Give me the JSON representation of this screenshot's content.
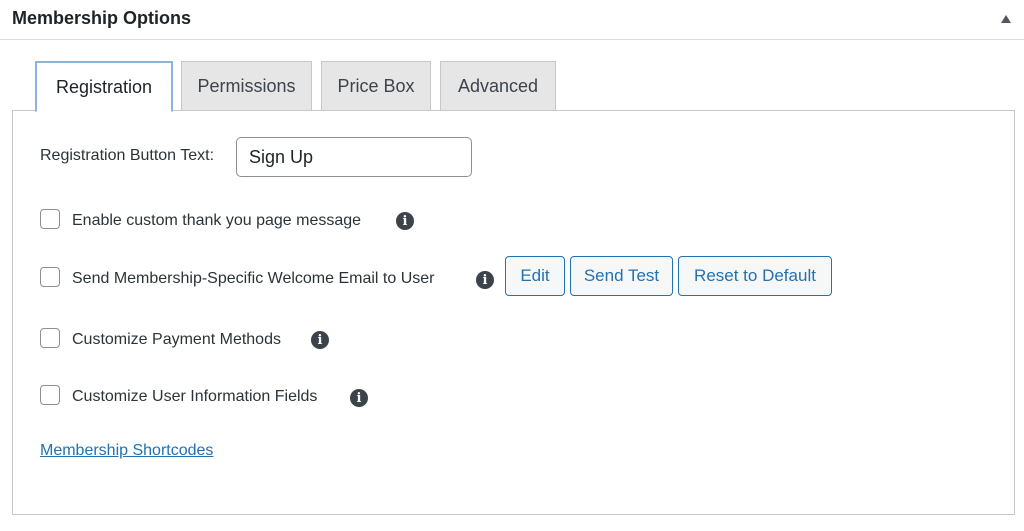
{
  "metabox": {
    "title": "Membership Options",
    "collapse_icon": "triangle-up-icon"
  },
  "tabs": [
    {
      "label": "Registration",
      "active": true
    },
    {
      "label": "Permissions",
      "active": false
    },
    {
      "label": "Price Box",
      "active": false
    },
    {
      "label": "Advanced",
      "active": false
    }
  ],
  "registration": {
    "button_text_label": "Registration Button Text:",
    "button_text_value": "Sign Up",
    "options": [
      {
        "label": "Enable custom thank you page message",
        "checked": false,
        "info_icon": "info-icon"
      },
      {
        "label": "Send Membership-Specific Welcome Email to User",
        "checked": false,
        "info_icon": "info-icon"
      },
      {
        "label": "Customize Payment Methods",
        "checked": false,
        "info_icon": "info-icon"
      },
      {
        "label": "Customize User Information Fields",
        "checked": false,
        "info_icon": "info-icon"
      }
    ],
    "email_buttons": {
      "edit": "Edit",
      "send_test": "Send Test",
      "reset": "Reset to Default"
    },
    "shortcodes_link": "Membership Shortcodes"
  },
  "colors": {
    "accent": "#2271b1",
    "text": "#1d2327",
    "border": "#c7c7c7",
    "tab_inactive_bg": "#e6e6e6",
    "active_tab_border": "#8fb3d6"
  }
}
